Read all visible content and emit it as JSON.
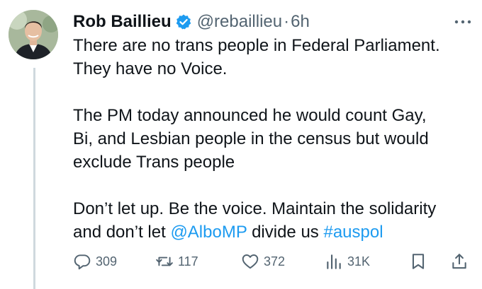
{
  "tweet": {
    "author_name": "Rob Baillieu",
    "handle": "@rebaillieu",
    "separator": "·",
    "time": "6h",
    "paragraphs": {
      "p1_line1": "There are no trans people in Federal Parliament.",
      "p1_line2": "They have no Voice.",
      "p2_line1": "The PM today announced he would count Gay,",
      "p2_line2": "Bi, and Lesbian people in the census but would",
      "p2_line3": "exclude Trans people",
      "p3_line1": "Don’t let up. Be the voice. Maintain the solidarity",
      "p3_line2_pre": "and don’t let ",
      "p3_mention": "@AlboMP",
      "p3_line2_mid": " divide us ",
      "p3_hashtag": "#auspol"
    }
  },
  "actions": {
    "replies": "309",
    "retweets": "117",
    "likes": "372",
    "views": "31K"
  },
  "icons": {
    "verified": "verified-badge-icon",
    "more": "more-options-icon",
    "reply": "reply-icon",
    "retweet": "retweet-icon",
    "like": "heart-icon",
    "views": "views-chart-icon",
    "bookmark": "bookmark-icon",
    "share": "share-icon"
  },
  "colors": {
    "link": "#1d9bf0",
    "muted": "#536471",
    "text": "#0f1419",
    "thread_line": "#cfd9de"
  }
}
